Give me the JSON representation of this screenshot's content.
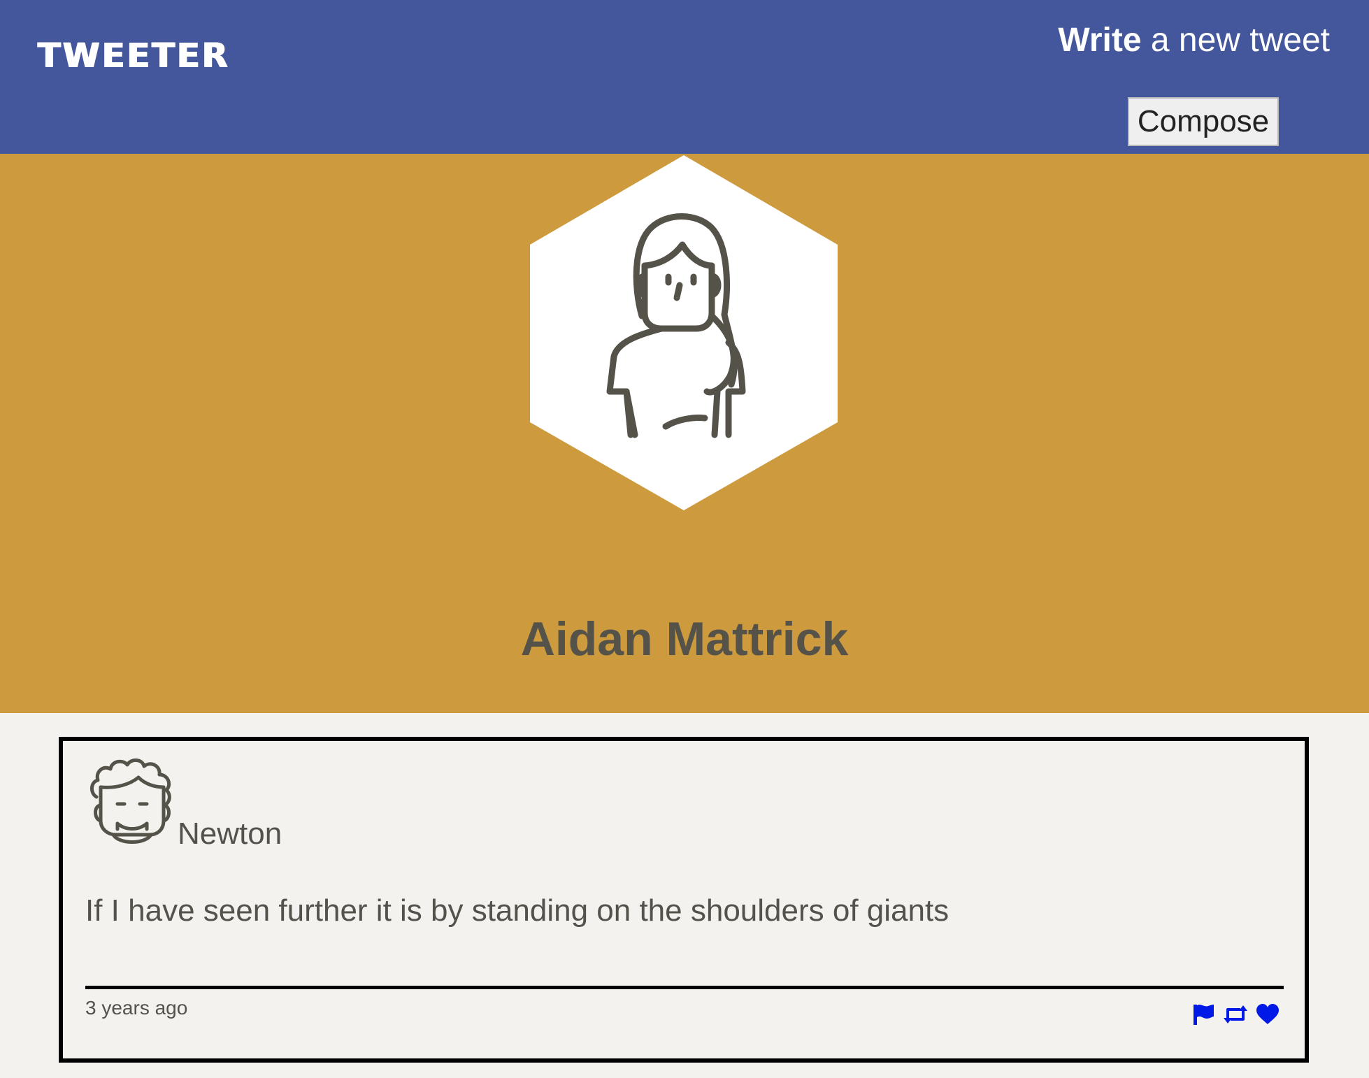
{
  "nav": {
    "brand": "TWEETER",
    "write_strong": "Write",
    "write_rest": " a new tweet",
    "compose_label": "Compose"
  },
  "profile": {
    "name": "Aidan Mattrick",
    "avatar_icon": "woman-avatar-icon"
  },
  "tweets": [
    {
      "author": "Newton",
      "avatar_icon": "man-avatar-icon",
      "text": "If I have seen further it is by standing on the shoulders of giants",
      "time": "3 years ago",
      "actions": [
        "flag-icon",
        "retweet-icon",
        "heart-icon"
      ]
    }
  ],
  "colors": {
    "nav_bg": "#44579c",
    "profile_bg": "#cd9a3e",
    "page_bg": "#f4f2ee",
    "text": "#54524a",
    "action_icons": "#0019e6"
  }
}
